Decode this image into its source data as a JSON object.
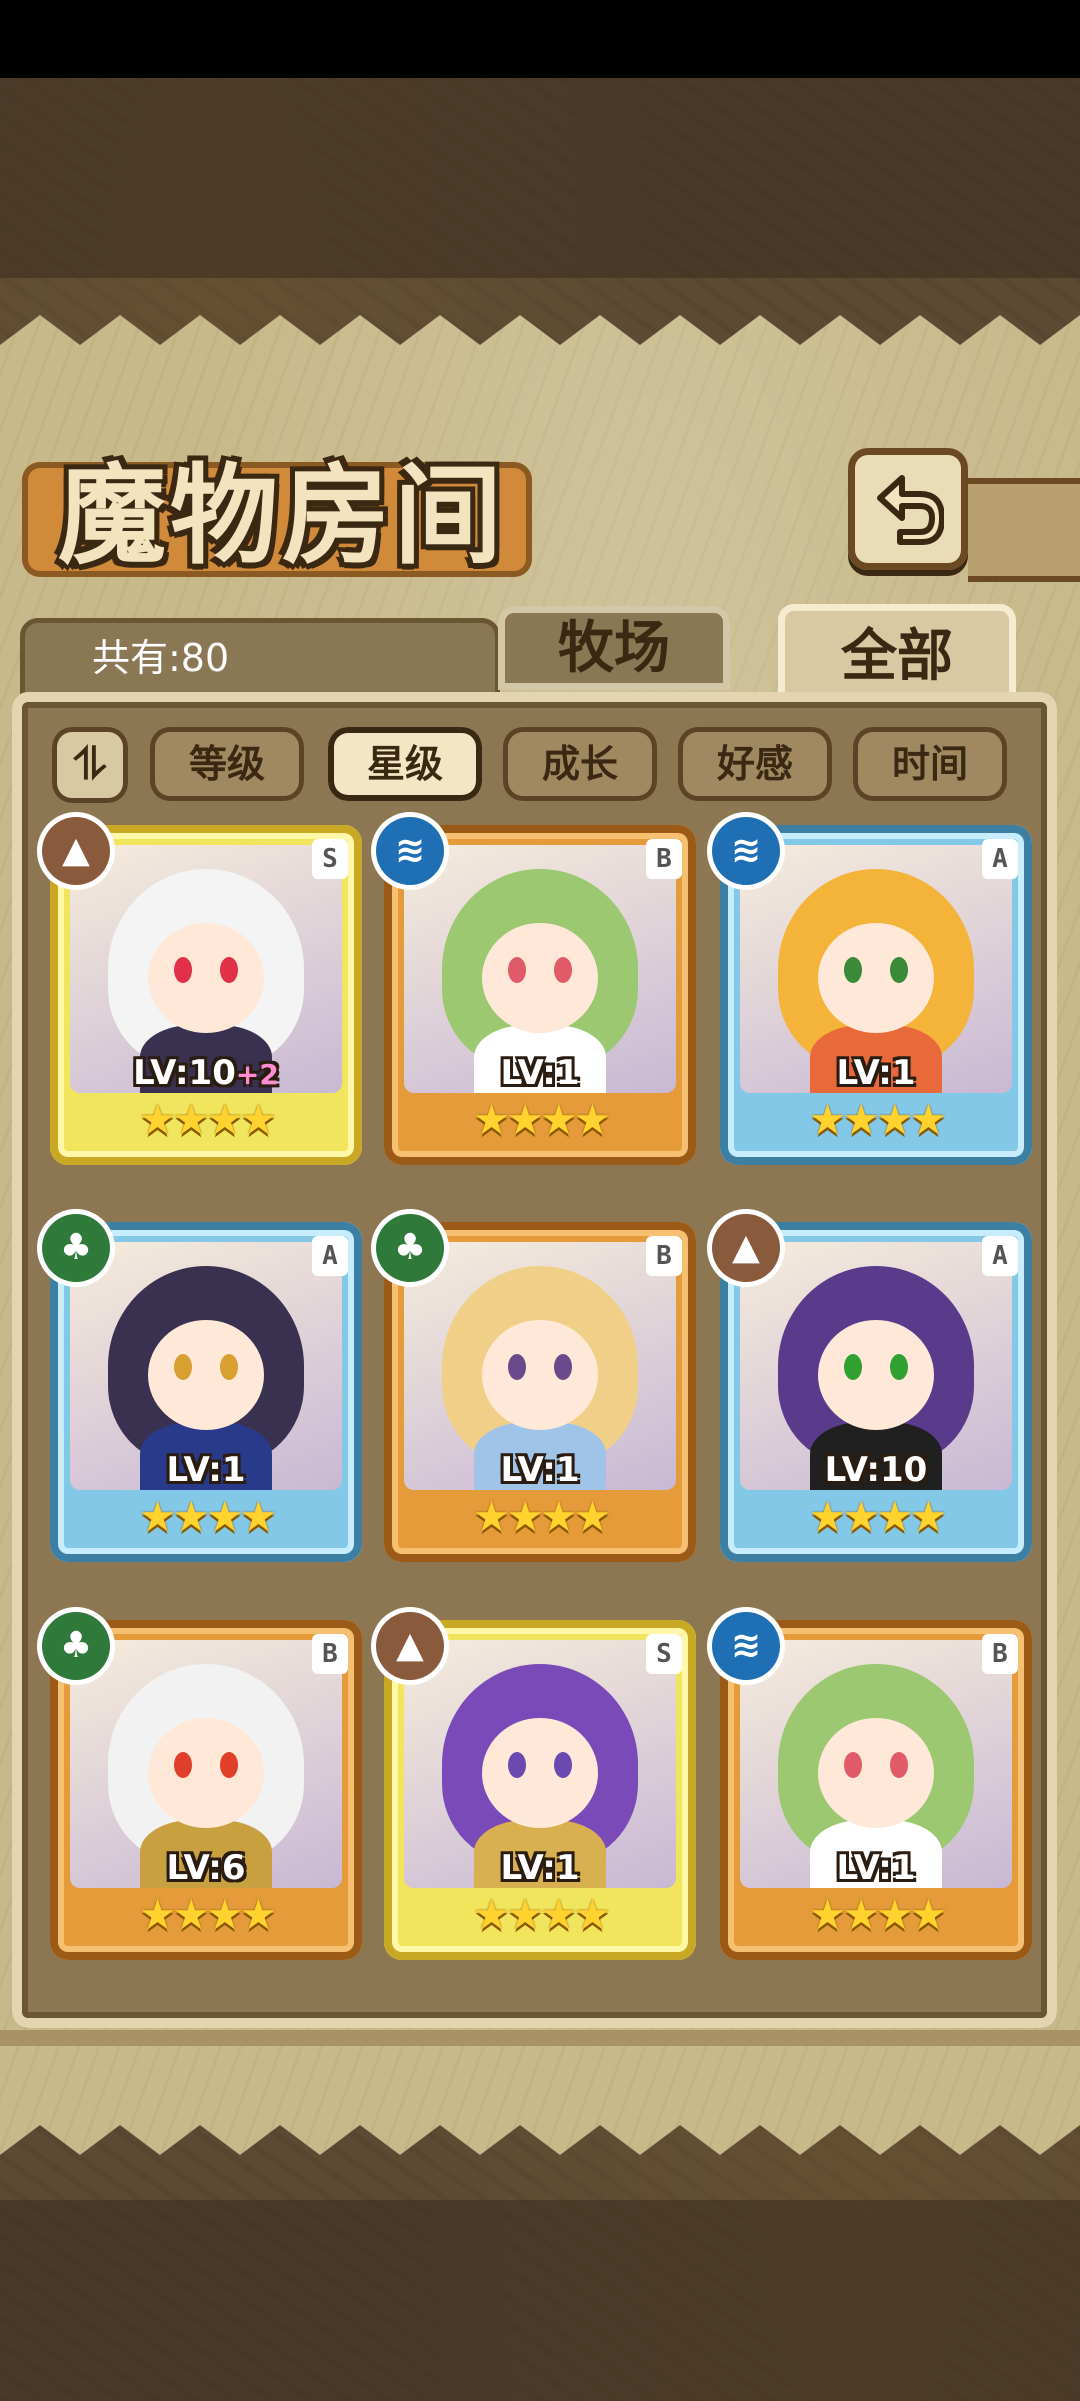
{
  "header": {
    "title": "魔物房间",
    "back_icon": "return-arrow-icon"
  },
  "summary": {
    "total_label": "共有:80"
  },
  "tabs": [
    {
      "label": "牧场",
      "active": false
    },
    {
      "label": "全部",
      "active": true
    }
  ],
  "sort": {
    "toggle_icon": "sort-order-icon",
    "options": [
      {
        "label": "等级",
        "active": false
      },
      {
        "label": "星级",
        "active": true
      },
      {
        "label": "成长",
        "active": false
      },
      {
        "label": "好感",
        "active": false
      },
      {
        "label": "时间",
        "active": false
      }
    ]
  },
  "monsters": [
    {
      "level": "LV:10",
      "bonus": "+2",
      "rank": "S",
      "stars": 4,
      "frame": "gold",
      "element": "earth-element-icon"
    },
    {
      "level": "LV:1",
      "bonus": "",
      "rank": "B",
      "stars": 4,
      "frame": "orange",
      "element": "water-element-icon"
    },
    {
      "level": "LV:1",
      "bonus": "",
      "rank": "A",
      "stars": 4,
      "frame": "blue",
      "element": "water-element-icon"
    },
    {
      "level": "LV:1",
      "bonus": "",
      "rank": "A",
      "stars": 4,
      "frame": "blue",
      "element": "grass-element-icon"
    },
    {
      "level": "LV:1",
      "bonus": "",
      "rank": "B",
      "stars": 4,
      "frame": "orange",
      "element": "grass-element-icon"
    },
    {
      "level": "LV:10",
      "bonus": "",
      "rank": "A",
      "stars": 4,
      "frame": "blue",
      "element": "earth-element-icon"
    },
    {
      "level": "LV:6",
      "bonus": "",
      "rank": "B",
      "stars": 4,
      "frame": "orange",
      "element": "grass-element-icon"
    },
    {
      "level": "LV:1",
      "bonus": "",
      "rank": "S",
      "stars": 4,
      "frame": "gold",
      "element": "earth-element-icon"
    },
    {
      "level": "LV:1",
      "bonus": "",
      "rank": "B",
      "stars": 4,
      "frame": "orange",
      "element": "water-element-icon"
    }
  ],
  "colors": {
    "gold_frame": "#f2e55e",
    "orange_frame": "#e59b3a",
    "blue_frame": "#84c8e8",
    "star": "#ffd22e"
  }
}
